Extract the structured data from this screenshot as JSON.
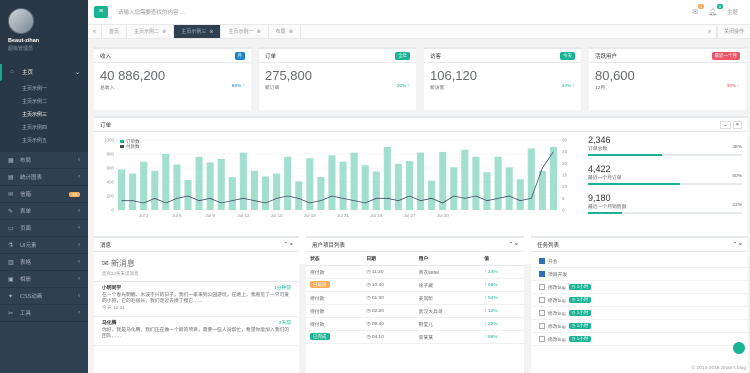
{
  "profile": {
    "name": "Beaut-zihan",
    "role": "超级管理员"
  },
  "sidebar": {
    "items": [
      {
        "label": "主页",
        "icon": "home-icon",
        "active": true
      },
      {
        "label": "布局",
        "icon": "layout-icon"
      },
      {
        "label": "统计图表",
        "icon": "chart-icon"
      },
      {
        "label": "信箱",
        "icon": "envelope-icon",
        "badge": "16"
      },
      {
        "label": "表单",
        "icon": "form-icon"
      },
      {
        "label": "页面",
        "icon": "page-icon"
      },
      {
        "label": "UI元素",
        "icon": "flask-icon"
      },
      {
        "label": "表格",
        "icon": "table-icon"
      },
      {
        "label": "相册",
        "icon": "picture-icon"
      },
      {
        "label": "CSS动画",
        "icon": "magic-icon"
      },
      {
        "label": "工具",
        "icon": "cutlery-icon"
      }
    ],
    "submenu": [
      "主页示例一",
      "主页示例二",
      "主页示例三",
      "主页示例四",
      "主页示例五"
    ],
    "submenu_current": 2
  },
  "topbar": {
    "search_placeholder": "请输入您需要查找的内容 …",
    "mail_badge": "4",
    "bell_badge": "8",
    "theme_label": "主题"
  },
  "tabs": {
    "items": [
      "首页",
      "主页示例二",
      "主页示例三",
      "主页示例一",
      "布局"
    ],
    "active": 2,
    "right_label": "关闭操作"
  },
  "stats": [
    {
      "title": "收入",
      "label": "月",
      "label_color": "#1c84c6",
      "value": "40 886,200",
      "sub": "总收入",
      "pct": "98% ↑"
    },
    {
      "title": "订单",
      "label": "全年",
      "label_color": "#1ab394",
      "value": "275,800",
      "sub": "新订单",
      "pct": "20% ↑"
    },
    {
      "title": "访客",
      "label": "今天",
      "label_color": "#1ab394",
      "value": "106,120",
      "sub": "新访客",
      "pct": "44% ↑"
    },
    {
      "title": "活跃用户",
      "label": "最近一个月",
      "label_color": "#ed5565",
      "value": "80,600",
      "sub": "12月",
      "pct": "38% ↓"
    }
  ],
  "orders_panel": {
    "title": "订单",
    "side_stats": [
      {
        "value": "2,346",
        "label": "订单总数",
        "pct": "48%",
        "fill": 0.48
      },
      {
        "value": "4,422",
        "label": "最近一个月订单",
        "pct": "60%",
        "fill": 0.6
      },
      {
        "value": "9,180",
        "label": "最近一个月销售额",
        "pct": "22%",
        "fill": 0.22
      }
    ]
  },
  "chart_data": {
    "type": "bar",
    "legend": [
      "订单数",
      "付款数"
    ],
    "x_ticks": [
      "Jul 3",
      "Jul 6",
      "Jul 9",
      "Jul 12",
      "Jul 15",
      "Jul 18",
      "Jul 21",
      "Jul 24",
      "Jul 27",
      "Jul 30"
    ],
    "ylim_left": [
      0,
      1000
    ],
    "y_ticks_left": [
      0,
      200,
      400,
      600,
      800,
      1000
    ],
    "ylim_right": [
      0,
      30
    ],
    "y_ticks_right": [
      0,
      5,
      10,
      15,
      20,
      25,
      30
    ],
    "bars": [
      580,
      520,
      690,
      560,
      800,
      650,
      430,
      760,
      680,
      730,
      470,
      820,
      560,
      480,
      520,
      760,
      410,
      740,
      470,
      780,
      690,
      820,
      640,
      550,
      900,
      660,
      700,
      820,
      420,
      830,
      610,
      860,
      760,
      540,
      760,
      610,
      440,
      880,
      560,
      900
    ],
    "line": [
      4,
      4,
      3,
      5,
      3,
      5,
      6,
      4,
      5,
      3,
      4,
      5,
      4,
      3,
      5,
      6,
      5,
      3,
      4,
      6,
      5,
      4,
      3,
      5,
      5,
      4,
      6,
      4,
      5,
      3,
      6,
      5,
      6,
      4,
      5,
      6,
      4,
      5,
      18,
      25
    ]
  },
  "messages": {
    "title": "消息",
    "header": "新消息",
    "sub": "您有22条未读消息",
    "items": [
      {
        "from": "小明同学",
        "time": "1分钟前",
        "text": "在一个春光明媚、水波不兴的日子，我们一家来到公园游玩，在路上，我看见了一只可爱的小狗，它的毛很长，我们走过去摸了摸它……",
        "date": "今天 12:01"
      },
      {
        "from": "马化腾",
        "time": "2天前",
        "text": "你好，我是马化腾，我们正在做一个新的项目，需要一些人员帮忙，希望你能加入我们的团队……",
        "date": ""
      }
    ]
  },
  "users_panel": {
    "title": "用户项目列表",
    "headers": [
      "状态",
      "日期",
      "用户",
      "值"
    ],
    "rows": [
      {
        "status": "待付款",
        "tag": "",
        "time": "◷ 11:20",
        "user": "青衣5858",
        "pct": "↑ 24%"
      },
      {
        "status": "",
        "tag": "已取消",
        "tag_color": "#f8ac59",
        "time": "◷ 10:40",
        "user": "徐子崴",
        "pct": "↑ 66%"
      },
      {
        "status": "待付款",
        "tag": "",
        "time": "◷ 01:30",
        "user": "姜岚昕",
        "pct": "↑ 54%"
      },
      {
        "status": "待付款",
        "tag": "",
        "time": "◷ 02:20",
        "user": "武汉大兵哥",
        "pct": "↑ 12%"
      },
      {
        "status": "待付款",
        "tag": "",
        "time": "◷ 09:40",
        "user": "荆莹儿",
        "pct": "↑ 22%"
      },
      {
        "status": "",
        "tag": "已完成",
        "tag_color": "#1ab394",
        "time": "◷ 04:10",
        "user": "栾某某",
        "pct": "↑ 66%"
      }
    ]
  },
  "tasks_panel": {
    "title": "任务列表",
    "items": [
      {
        "text": "开会",
        "checked": true,
        "label": ""
      },
      {
        "text": "项目开发",
        "checked": true,
        "label": ""
      },
      {
        "text": "修改bug",
        "checked": false,
        "label": "1小时"
      },
      {
        "text": "修改bug",
        "checked": false,
        "label": "1小时"
      },
      {
        "text": "修改bug",
        "checked": false,
        "label": "1小时"
      },
      {
        "text": "修改bug",
        "checked": false,
        "label": "1小时"
      },
      {
        "text": "修改bug",
        "checked": false,
        "label": "1小时"
      }
    ]
  },
  "footer": "© 2014-2015 zihan's blog"
}
